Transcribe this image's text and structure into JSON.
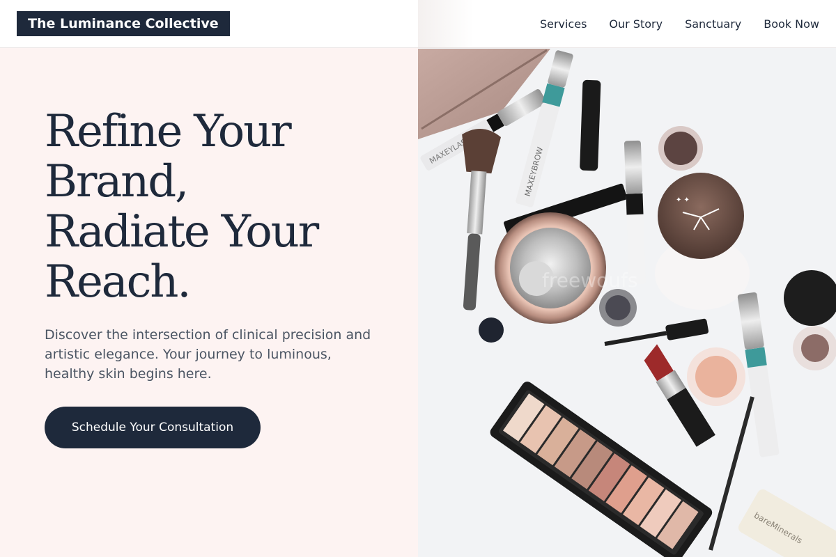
{
  "header": {
    "brand": "The Luminance Collective",
    "nav": [
      "Services",
      "Our Story",
      "Sanctuary",
      "Book Now"
    ]
  },
  "hero": {
    "title": "Refine Your\nBrand,\nRadiate Your\nReach.",
    "subtitle": "Discover the intersection of clinical precision and artistic elegance. Your journey to luminous, healthy skin begins here.",
    "cta": "Schedule Your Consultation"
  },
  "image": {
    "label_brow": "MAXEYBROW",
    "label_lash": "MAXEYLASH",
    "label_tube": "bareMinerals",
    "watermark": "freewoufs"
  },
  "colors": {
    "navy": "#1e293b",
    "blush_background": "#fdf3f2",
    "body_text": "#4b5563"
  }
}
